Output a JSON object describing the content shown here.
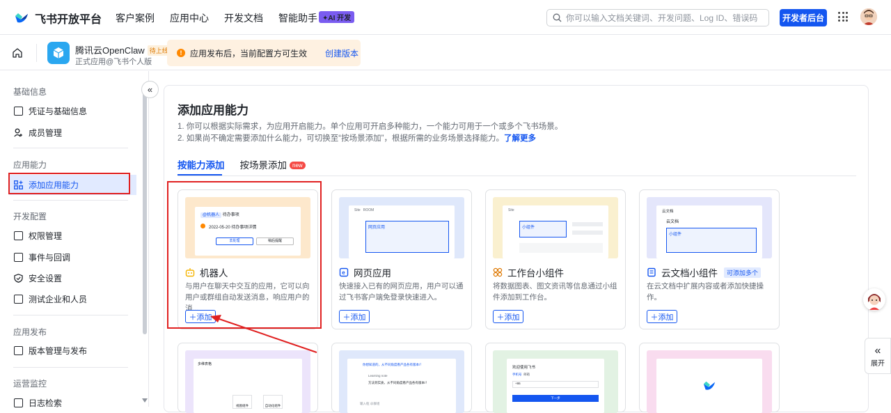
{
  "topbar": {
    "brand": "飞书开放平台",
    "nav": [
      "客户案例",
      "应用中心",
      "开发文档",
      "智能助手"
    ],
    "ai_badge": "✦AI 开发",
    "search_placeholder": "你可以输入文档关键词、开发问题、Log ID、错误码",
    "dev_button": "开发者后台"
  },
  "app": {
    "name": "腾讯云OpenClaw",
    "status": "待上线",
    "subtitle": "正式应用@飞书个人版",
    "notice": "应用发布后，当前配置方可生效",
    "notice_link": "创建版本"
  },
  "sidebar": {
    "groups": [
      {
        "label": "基础信息",
        "items": [
          "凭证与基础信息",
          "成员管理"
        ]
      },
      {
        "label": "应用能力",
        "items": [
          "添加应用能力"
        ]
      },
      {
        "label": "开发配置",
        "items": [
          "权限管理",
          "事件与回调",
          "安全设置",
          "测试企业和人员"
        ]
      },
      {
        "label": "应用发布",
        "items": [
          "版本管理与发布"
        ]
      },
      {
        "label": "运营监控",
        "items": [
          "日志检索"
        ]
      }
    ],
    "active_item": "添加应用能力"
  },
  "main": {
    "title": "添加应用能力",
    "desc1": "1. 你可以根据实际需求，为应用开启能力。单个应用可开启多种能力，一个能力可用于一个或多个飞书场景。",
    "desc2": "2. 如果尚不确定需要添加什么能力，可切换至“按场景添加”，根据所需的业务场景选择能力。",
    "learn_more": "了解更多",
    "tabs": [
      "按能力添加",
      "按场景添加"
    ],
    "new_badge": "new",
    "add_label": "＋添加",
    "cards": [
      {
        "title": "机器人",
        "desc": "与用户在聊天中交互的应用，它可以向用户或群组自动发送消息，响应用户的消...",
        "accent": "#f5b400"
      },
      {
        "title": "网页应用",
        "desc": "快速接入已有的网页应用，用户可以通过飞书客户端免登录快速进入。",
        "accent": "#1456f0"
      },
      {
        "title": "工作台小组件",
        "desc": "将数据图表、图文资讯等信息通过小组件添加到工作台。",
        "accent": "#de7802"
      },
      {
        "title": "云文档小组件",
        "desc": "在云文档中扩展内容或者添加快捷操作。",
        "accent": "#1456f0",
        "badge": "可添加多个"
      }
    ],
    "bot_preview": {
      "chip": "@机器人",
      "chip2": "待办事项",
      "line": "2022-05-20 待办事项详情",
      "btn1": "去处理",
      "btn2": "稍后提醒"
    },
    "web_preview": {
      "tab1": "Site",
      "tab2": "ROOM",
      "title": "网页应用"
    },
    "widget_preview": {
      "tab": "Site",
      "title": "小组件"
    },
    "doc_preview": {
      "head": "云文档",
      "doc": "云文档",
      "title": "小组件"
    },
    "row2_previews": {
      "a_title": "多维表格",
      "a_btn1": "视图组件",
      "a_btn2": "自动化组件",
      "b_line1": "你想知道的，从不同角度看产品各有版本/！",
      "b_line2": "Learning note",
      "b_line3": "方法到实质，从不同角度看产品各有版本/！",
      "b_input": "输入框 @群组",
      "c_title": "欢迎使用飞书",
      "c_tab1": "手机号",
      "c_tab2": "邮箱",
      "c_code": "+86",
      "c_btn": "下一步"
    }
  },
  "floating": {
    "expand": "展开"
  }
}
